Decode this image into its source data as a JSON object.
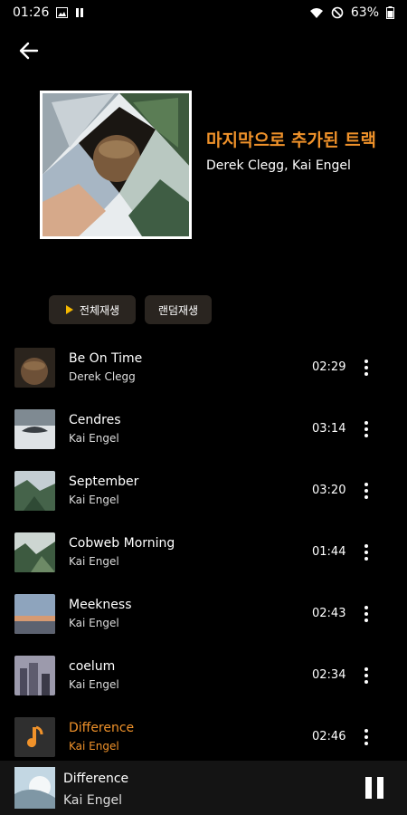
{
  "status_bar": {
    "time": "01:26",
    "battery": "63%",
    "icons": [
      "image-icon",
      "pause-status-icon",
      "wifi-icon",
      "do-not-disturb-icon",
      "battery-icon"
    ]
  },
  "header": {
    "back_icon": "arrow-left-icon"
  },
  "playlist": {
    "title": "마지막으로 추가된 트랙",
    "artists": "Derek Clegg, Kai Engel"
  },
  "actions": {
    "play_all": "전체재생",
    "shuffle": "랜덤재생"
  },
  "tracks": [
    {
      "title": "Be On Time",
      "artist": "Derek Clegg",
      "duration": "02:29"
    },
    {
      "title": "Cendres",
      "artist": "Kai Engel",
      "duration": "03:14"
    },
    {
      "title": "September",
      "artist": "Kai Engel",
      "duration": "03:20"
    },
    {
      "title": "Cobweb Morning",
      "artist": "Kai Engel",
      "duration": "01:44"
    },
    {
      "title": "Meekness",
      "artist": "Kai Engel",
      "duration": "02:43"
    },
    {
      "title": "coelum",
      "artist": "Kai Engel",
      "duration": "02:34"
    },
    {
      "title": "Difference",
      "artist": "Kai Engel",
      "duration": "02:46",
      "active": true
    }
  ],
  "now_playing": {
    "title": "Difference",
    "artist": "Kai Engel"
  },
  "colors": {
    "accent": "#f0922a",
    "background": "#000000",
    "chip": "#2a2520"
  }
}
